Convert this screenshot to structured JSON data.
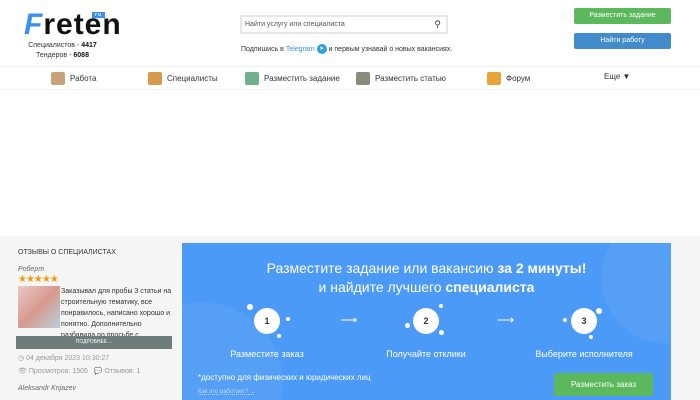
{
  "header": {
    "logo": {
      "first": "F",
      "rest": "reten",
      "badge": "ru"
    },
    "stats": {
      "specialists_label": "Специалистов - ",
      "specialists_count": "4417",
      "tenders_label": "Тендеров - ",
      "tenders_count": "6088"
    },
    "search": {
      "placeholder": "Найти услугу или специалиста"
    },
    "telegram": {
      "before": "Подпишись в ",
      "link": "Telegram",
      "after": " и первым узнавай о новых вакансиях."
    },
    "post_task_button": "Разместить задание",
    "find_work_button": "Найти работу"
  },
  "nav": {
    "items": [
      {
        "label": "Работа"
      },
      {
        "label": "Специалисты"
      },
      {
        "label": "Разместить задание"
      },
      {
        "label": "Разместить статью"
      },
      {
        "label": "Форум"
      },
      {
        "label": "Еще ▼"
      }
    ]
  },
  "sidebar": {
    "title": "Отзывы о специалистах",
    "review": {
      "author": "Роберт",
      "stars": "★★★★★",
      "rating": 5,
      "text": "Заказывал для пробы 3 статьи на строительную тематику, все понравилось, написано хорошо и понятно. Дополнительно разбавила по просьбе с",
      "more_button": "ПОДРОБНЕЕ→",
      "date": "04 декабря 2023 10:30:27",
      "views": "Просмотров: 1505",
      "reviews": "Отзывов: 1"
    },
    "next_author": "Aleksandr Knjazev"
  },
  "promo": {
    "line1_normal": "Разместите задание или вакансию ",
    "line1_bold": "за 2 минуты!",
    "line2_normal": "и найдите лучшего ",
    "line2_bold": "специалиста",
    "steps": [
      {
        "num": "1",
        "label": "Разместите заказ"
      },
      {
        "num": "2",
        "label": "Получайте отклики"
      },
      {
        "num": "3",
        "label": "Выберите исполнителя"
      }
    ],
    "note": "*доступно для физических и юридических лиц",
    "how_link": "Как это работает?",
    "order_button": "Разместить заказ"
  }
}
